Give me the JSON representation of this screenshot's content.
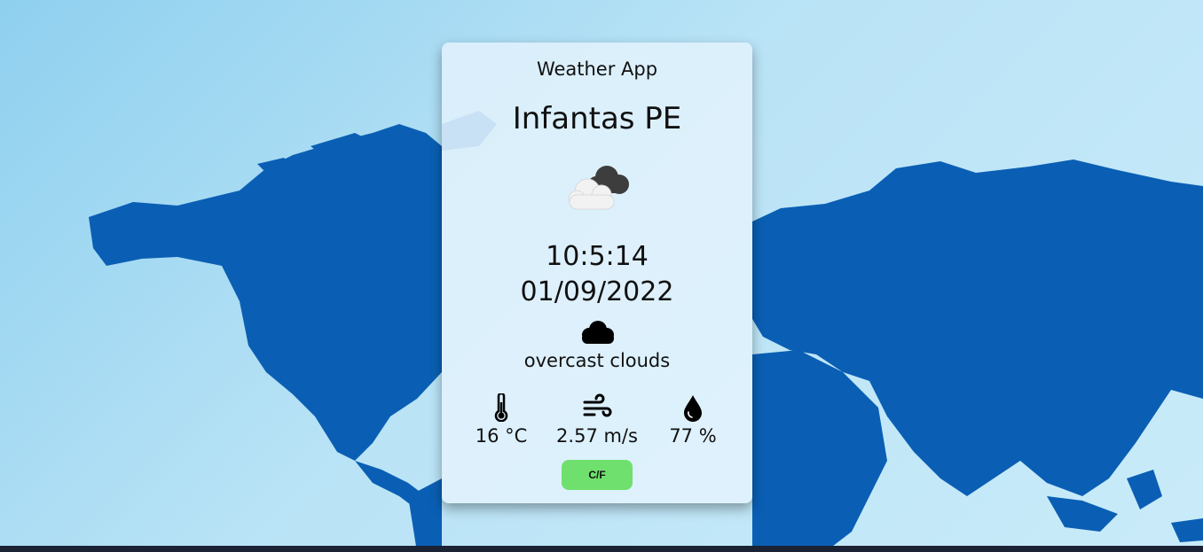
{
  "app": {
    "title": "Weather App"
  },
  "location": {
    "city": "Infantas PE"
  },
  "weather": {
    "icon": "overcast-clouds-icon",
    "time": "10:5:14",
    "date": "01/09/2022",
    "condition_icon": "cloud-icon",
    "condition": "overcast clouds"
  },
  "stats": {
    "temperature": {
      "icon": "thermometer-icon",
      "value": "16 °C"
    },
    "wind": {
      "icon": "wind-icon",
      "value": "2.57 m/s"
    },
    "humidity": {
      "icon": "droplet-icon",
      "value": "77 %"
    }
  },
  "controls": {
    "unit_toggle_label": "C/F"
  },
  "colors": {
    "map_land": "#0a5fb4",
    "background": "#b9e3f6",
    "toggle_button": "#6fe06e"
  }
}
